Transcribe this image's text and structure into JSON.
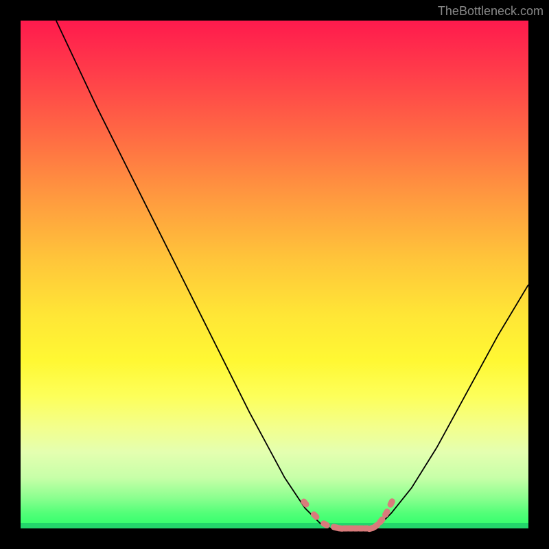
{
  "watermark": "TheBottleneck.com",
  "colors": {
    "background": "#000000",
    "curve": "#000000",
    "marker": "#d97b7b",
    "gradient_top": "#ff1a4d",
    "gradient_bottom": "#2dff6a"
  },
  "chart_data": {
    "type": "line",
    "title": "",
    "xlabel": "",
    "ylabel": "",
    "xlim": [
      0,
      100
    ],
    "ylim": [
      0,
      100
    ],
    "series": [
      {
        "name": "left-curve",
        "x": [
          7,
          15,
          25,
          35,
          45,
          52,
          56,
          59,
          61
        ],
        "y": [
          100,
          83,
          63,
          43,
          23,
          10,
          4,
          1,
          0
        ]
      },
      {
        "name": "right-curve",
        "x": [
          70,
          73,
          77,
          82,
          88,
          94,
          100
        ],
        "y": [
          0,
          3,
          8,
          16,
          27,
          38,
          48
        ]
      },
      {
        "name": "flat-bottom",
        "x": [
          61,
          63,
          65,
          67,
          69,
          70
        ],
        "y": [
          0,
          0,
          0,
          0,
          0,
          0
        ]
      }
    ],
    "markers": {
      "name": "highlight-segment",
      "x": [
        56,
        58,
        60,
        62,
        63,
        64,
        65,
        66,
        67,
        68,
        69,
        70,
        71,
        72,
        73
      ],
      "y": [
        5,
        2.5,
        0.8,
        0.2,
        0,
        0,
        0,
        0,
        0,
        0,
        0,
        0.5,
        1.5,
        3,
        5
      ]
    }
  }
}
